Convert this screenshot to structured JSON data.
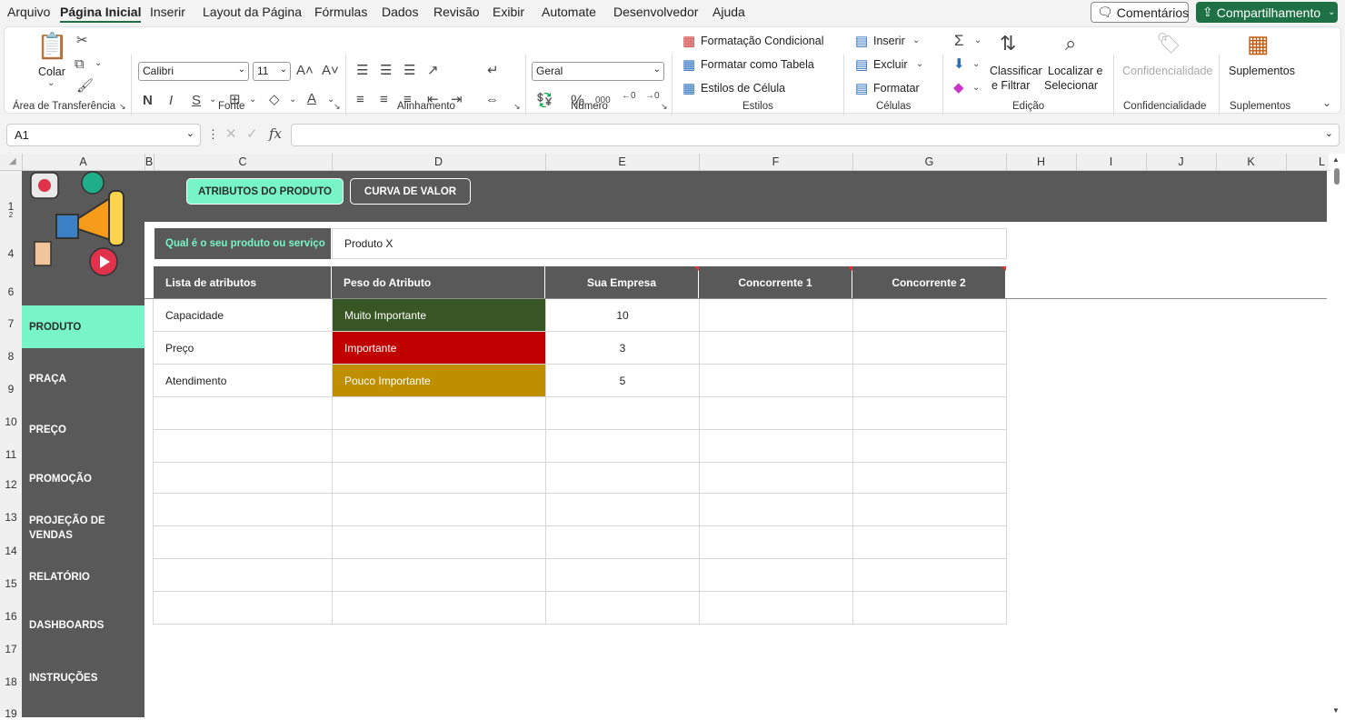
{
  "menu": {
    "items": [
      "Arquivo",
      "Página Inicial",
      "Inserir",
      "Layout da Página",
      "Fórmulas",
      "Dados",
      "Revisão",
      "Exibir",
      "Automate",
      "Desenvolvedor",
      "Ajuda"
    ],
    "comments": "Comentários",
    "share": "Compartilhamento"
  },
  "ribbon": {
    "clipboard": {
      "paste": "Colar",
      "label": "Área de Transferência"
    },
    "font": {
      "name": "Calibri",
      "size": "11",
      "label": "Fonte"
    },
    "alignment": {
      "label": "Alinhamento"
    },
    "number": {
      "format": "Geral",
      "label": "Número"
    },
    "styles": {
      "conditional": "Formatação Condicional",
      "table": "Formatar como Tabela",
      "cell": "Estilos de Célula",
      "label": "Estilos"
    },
    "cells": {
      "insert": "Inserir",
      "delete": "Excluir",
      "format": "Formatar",
      "label": "Células"
    },
    "editing": {
      "sort_1": "Classificar",
      "sort_2": "e Filtrar",
      "find_1": "Localizar e",
      "find_2": "Selecionar",
      "label": "Edição"
    },
    "sensitivity": {
      "btn": "Confidencialidade",
      "label": "Confidencialidade"
    },
    "addins": {
      "btn": "Suplementos",
      "label": "Suplementos"
    }
  },
  "formula_bar": {
    "name_box": "A1",
    "fx": "fx",
    "value": ""
  },
  "columns": [
    "A",
    "B",
    "C",
    "D",
    "E",
    "F",
    "G",
    "H",
    "I",
    "J",
    "K",
    "L"
  ],
  "rows": [
    "1",
    "2",
    "4",
    "6",
    "7",
    "8",
    "9",
    "10",
    "11",
    "12",
    "13",
    "14",
    "15",
    "16",
    "17",
    "18",
    "19"
  ],
  "nav_buttons": [
    {
      "label": "ATRIBUTOS DO PRODUTO",
      "active": true
    },
    {
      "label": "CURVA DE VALOR",
      "active": false
    }
  ],
  "sidebar": [
    {
      "label": "PRODUTO",
      "active": true
    },
    {
      "label": "PRAÇA"
    },
    {
      "label": "PREÇO"
    },
    {
      "label": "PROMOÇÃO"
    },
    {
      "label": "PROJEÇÃO DE VENDAS"
    },
    {
      "label": "RELATÓRIO"
    },
    {
      "label": "DASHBOARDS"
    },
    {
      "label": "INSTRUÇÕES"
    }
  ],
  "question": {
    "label": "Qual é o seu produto ou serviço",
    "value": "Produto X"
  },
  "table": {
    "headers": [
      "Lista de atributos",
      "Peso do Atributo",
      "Sua Empresa",
      "Concorrente 1",
      "Concorrente 2"
    ],
    "rows": [
      {
        "attr": "Capacidade",
        "weight": "Muito Importante",
        "weight_color": "#375623",
        "company": "10",
        "c1": "",
        "c2": ""
      },
      {
        "attr": "Preço",
        "weight": "Importante",
        "weight_color": "#c00000",
        "company": "3",
        "c1": "",
        "c2": ""
      },
      {
        "attr": "Atendimento",
        "weight": "Pouco Importante",
        "weight_color": "#bf8f00",
        "company": "5",
        "c1": "",
        "c2": ""
      }
    ]
  },
  "colors": {
    "accent": "#78f5c8",
    "dark": "#595959",
    "excel_green": "#1e7145"
  }
}
